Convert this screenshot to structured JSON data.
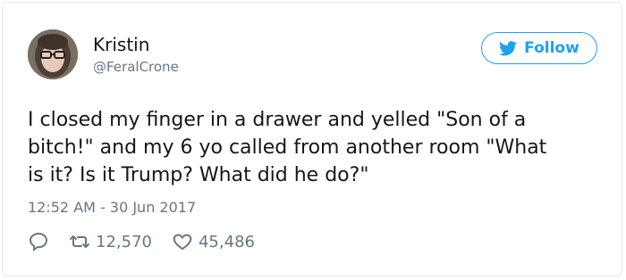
{
  "user": {
    "name": "Kristin",
    "handle": "@FeralCrone"
  },
  "follow_label": "Follow",
  "tweet": {
    "text": "I closed my finger in a drawer and yelled \"Son of a\nbitch!\" and my 6 yo called from another room \"What\nis it? Is it Trump? What did he do?\"",
    "timestamp": "12:52 AM - 30 Jun 2017"
  },
  "stats": {
    "retweets": "12,570",
    "likes": "45,486"
  },
  "colors": {
    "accent": "#1da1f2",
    "muted": "#657786",
    "text": "#14171a"
  },
  "icons": [
    "reply-icon",
    "retweet-icon",
    "like-icon",
    "twitter-bird-icon"
  ]
}
